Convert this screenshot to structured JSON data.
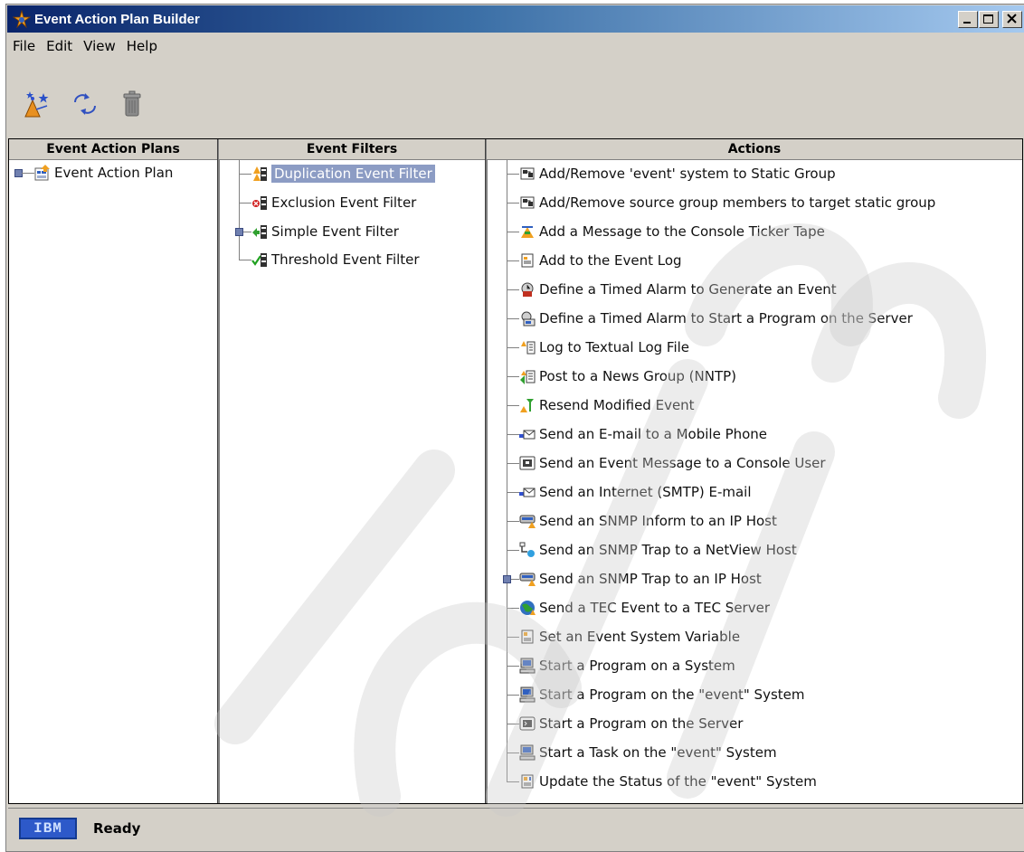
{
  "window": {
    "title": "Event Action Plan Builder"
  },
  "menu": [
    "File",
    "Edit",
    "View",
    "Help"
  ],
  "toolbar": [
    {
      "name": "new-wizard",
      "icon": "wizard-icon"
    },
    {
      "name": "refresh",
      "icon": "refresh-icon"
    },
    {
      "name": "delete",
      "icon": "trash-icon"
    }
  ],
  "columns": {
    "plans": {
      "header": "Event Action Plans",
      "items": [
        {
          "label": "Event Action Plan",
          "icon": "plan-icon"
        }
      ]
    },
    "filters": {
      "header": "Event Filters",
      "items": [
        {
          "label": "Duplication Event Filter",
          "icon": "duplication-filter-icon",
          "selected": true
        },
        {
          "label": "Exclusion Event Filter",
          "icon": "exclusion-filter-icon"
        },
        {
          "label": "Simple Event Filter",
          "icon": "simple-filter-icon"
        },
        {
          "label": "Threshold Event Filter",
          "icon": "threshold-filter-icon"
        }
      ]
    },
    "actions": {
      "header": "Actions",
      "items": [
        {
          "label": "Add/Remove 'event' system to Static Group",
          "icon": "group-icon"
        },
        {
          "label": "Add/Remove source group members to target static group",
          "icon": "group-icon"
        },
        {
          "label": "Add a Message to the Console Ticker Tape",
          "icon": "ticker-icon"
        },
        {
          "label": "Add to the Event Log",
          "icon": "log-icon"
        },
        {
          "label": "Define a Timed Alarm to Generate an Event",
          "icon": "alarm-icon"
        },
        {
          "label": "Define a Timed Alarm to Start a Program on the Server",
          "icon": "alarm-program-icon"
        },
        {
          "label": "Log to Textual Log File",
          "icon": "textfile-icon"
        },
        {
          "label": "Post to a News Group (NNTP)",
          "icon": "news-icon"
        },
        {
          "label": "Resend Modified Event",
          "icon": "resend-icon"
        },
        {
          "label": "Send an E-mail to a Mobile Phone",
          "icon": "email-icon"
        },
        {
          "label": "Send an Event Message to a Console User",
          "icon": "console-message-icon"
        },
        {
          "label": "Send an Internet (SMTP) E-mail",
          "icon": "email-icon"
        },
        {
          "label": "Send an SNMP Inform to an IP Host",
          "icon": "snmp-icon"
        },
        {
          "label": "Send an SNMP Trap to a NetView Host",
          "icon": "netview-icon"
        },
        {
          "label": "Send an SNMP Trap to an IP Host",
          "icon": "snmp-icon"
        },
        {
          "label": "Send a TEC Event to a TEC Server",
          "icon": "globe-icon"
        },
        {
          "label": "Set an Event System Variable",
          "icon": "variable-icon"
        },
        {
          "label": "Start a Program on a System",
          "icon": "computer-icon"
        },
        {
          "label": "Start a Program on the \"event\" System",
          "icon": "computer-icon"
        },
        {
          "label": "Start a Program on the Server",
          "icon": "server-program-icon"
        },
        {
          "label": "Start a Task on the \"event\" System",
          "icon": "computer-icon"
        },
        {
          "label": "Update the Status of the \"event\" System",
          "icon": "status-icon"
        }
      ]
    }
  },
  "status": {
    "logo": "IBM",
    "text": "Ready"
  }
}
